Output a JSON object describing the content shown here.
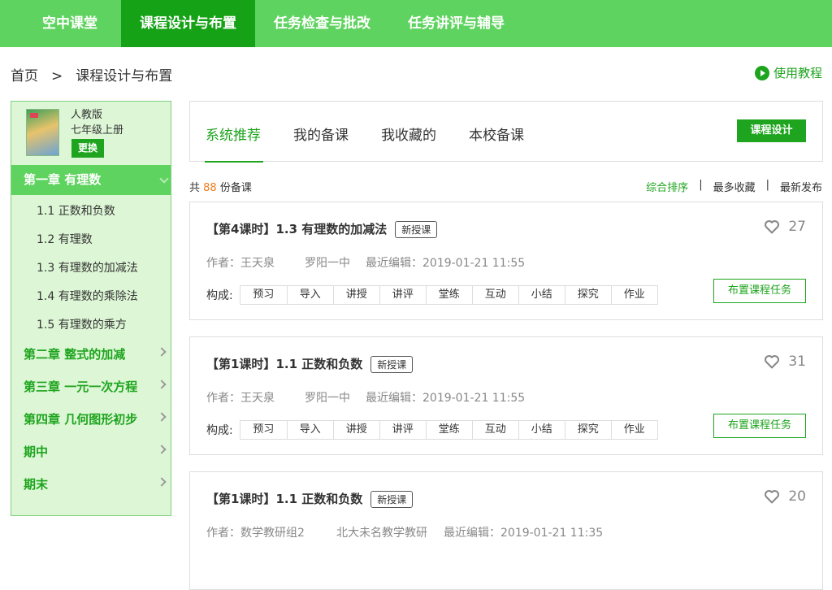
{
  "topnav": [
    "空中课堂",
    "课程设计与布置",
    "任务检查与批改",
    "任务讲评与辅导"
  ],
  "breadcrumb": {
    "home": "首页",
    "sep": ">",
    "current": "课程设计与布置"
  },
  "tutorial": "使用教程",
  "book": {
    "publisher": "人教版",
    "grade": "七年级上册",
    "change": "更换"
  },
  "chapters": {
    "active": "第一章 有理数",
    "sections": [
      "1.1 正数和负数",
      "1.2 有理数",
      "1.3 有理数的加减法",
      "1.4 有理数的乘除法",
      "1.5 有理数的乘方"
    ],
    "others": [
      "第二章 整式的加减",
      "第三章 一元一次方程",
      "第四章 几何图形初步",
      "期中",
      "期末"
    ]
  },
  "tabs": [
    "系统推荐",
    "我的备课",
    "我收藏的",
    "本校备课"
  ],
  "design_button": "课程设计",
  "count": {
    "prefix": "共 ",
    "num": "88",
    "suffix": " 份备课"
  },
  "sorts": [
    "综合排序",
    "最多收藏",
    "最新发布"
  ],
  "sort_sep": "|",
  "composition_label": "构成:",
  "tags": [
    "预习",
    "导入",
    "讲授",
    "讲评",
    "堂练",
    "互动",
    "小结",
    "探究",
    "作业"
  ],
  "assign_label": "布置课程任务",
  "cards": [
    {
      "title": "【第4课时】1.3 有理数的加减法",
      "badge": "新授课",
      "likes": "27",
      "author": "作者：王天泉",
      "school": "罗阳一中",
      "edited": "最近编辑：2019-01-21 11:55"
    },
    {
      "title": "【第1课时】1.1 正数和负数",
      "badge": "新授课",
      "likes": "31",
      "author": "作者：王天泉",
      "school": "罗阳一中",
      "edited": "最近编辑：2019-01-21 11:55"
    },
    {
      "title": "【第1课时】1.1 正数和负数",
      "badge": "新授课",
      "likes": "20",
      "author": "作者：数学教研组2",
      "school": "北大未名教学教研",
      "edited": "最近编辑：2019-01-21 11:35"
    }
  ],
  "colors": {
    "nav": "#5fd35f",
    "nav_active": "#16a216",
    "accent": "#1ea41e",
    "count": "#f07b1a"
  }
}
